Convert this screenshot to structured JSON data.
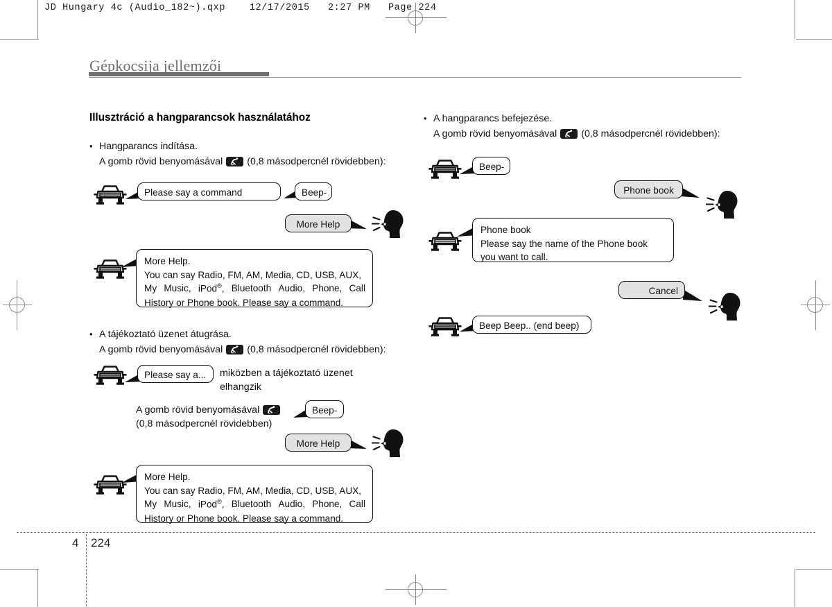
{
  "print_header": "JD Hungary 4c (Audio_182~).qxp    12/17/2015   2:27 PM   Page 224",
  "chapter": {
    "title": "Gépkocsija jellemzői",
    "number": "4",
    "page": "224"
  },
  "colors": {
    "title_gray": "#6e6e6e",
    "rule_gray": "#6d6d6d",
    "bubble_gray": "#e2e2e2",
    "ink": "#111111"
  },
  "left_column": {
    "heading": "Illusztráció a hangparancsok használatához",
    "step1": {
      "bullet": "Hangparancs indítása.",
      "press_prefix": "A gomb rövid benyomásával",
      "press_suffix": "(0,8 másodpercnél rövidebben):",
      "button_icon": "voice-command-button-icon",
      "bubble_command": "Please say a command",
      "bubble_beep": "Beep-",
      "bubble_more_help": "More Help",
      "help_title": "More Help.",
      "help_line1": "You can say Radio, FM, AM, Media, CD, USB, AUX,",
      "help_line2_a": "My Music, iPod",
      "help_line2_reg": "®",
      "help_line2_b": ", Bluetooth Audio, Phone, Call",
      "help_line3": "History or Phone book. Please say a command."
    },
    "step2": {
      "bullet": "A tájékoztató üzenet átugrása.",
      "press_prefix": "A gomb rövid benyomásával",
      "press_suffix": "(0,8 másodpercnél rövidebben):",
      "bubble_partial": "Please say a...",
      "side_note_line1": "miközben a tájékoztató üzenet",
      "side_note_line2": "elhangzik",
      "press2_line1_prefix": "A gomb rövid benyomásával",
      "press2_line2": "(0,8 másodpercnél rövidebben)",
      "bubble_beep": "Beep-",
      "bubble_more_help": "More Help",
      "help_title": "More Help.",
      "help_line1": "You can say Radio, FM, AM, Media, CD, USB, AUX,",
      "help_line2_a": "My Music, iPod",
      "help_line2_reg": "®",
      "help_line2_b": ", Bluetooth Audio, Phone, Call",
      "help_line3": "History or Phone book. Please say a command."
    }
  },
  "right_column": {
    "step3": {
      "bullet": "A hangparancs befejezése.",
      "press_prefix": "A gomb rövid benyomásával",
      "press_suffix": "(0,8 másodpercnél rövidebben):",
      "bubble_beep": "Beep-",
      "bubble_phone_book_user": "Phone book",
      "car_reply_line1": "Phone book",
      "car_reply_line2": "Please say the name of the Phone book",
      "car_reply_line3": "you want to call.",
      "bubble_cancel": "Cancel",
      "bubble_end_beep": "Beep Beep.. (end beep)"
    }
  }
}
